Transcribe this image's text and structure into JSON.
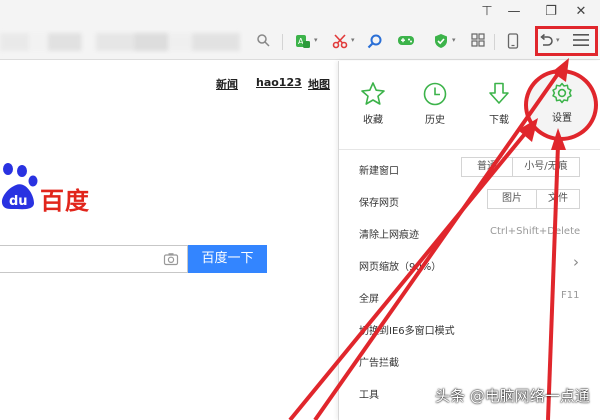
{
  "window_controls": {
    "skin": "⊤",
    "minimize": "—",
    "restore": "❐",
    "close": "✕"
  },
  "toolbar": {
    "search_icon": "search-icon",
    "caret": "▾"
  },
  "page": {
    "top_links": [
      "新闻",
      "hao123",
      "地图"
    ],
    "logo_text": "百度",
    "search_placeholder": "",
    "search_button": "百度一下"
  },
  "panel": {
    "quick": [
      {
        "icon": "star-icon",
        "label": "收藏"
      },
      {
        "icon": "clock-icon",
        "label": "历史"
      },
      {
        "icon": "download-icon",
        "label": "下载"
      },
      {
        "icon": "gear-icon",
        "label": "设置"
      }
    ],
    "new_window": {
      "label": "新建窗口",
      "btn1": "普通",
      "btn2": "小号/无痕"
    },
    "save_page": {
      "label": "保存网页",
      "btn1": "图片",
      "btn2": "文件"
    },
    "clear_traces": {
      "label": "清除上网痕迹",
      "shortcut": "Ctrl+Shift+Delete"
    },
    "zoom": {
      "label": "网页缩放（90%）",
      "arrow": "›"
    },
    "fullscreen": {
      "label": "全屏",
      "shortcut": "F11"
    },
    "ie6_mode": {
      "label": "切换到IE6多窗口模式"
    },
    "ad_block": {
      "label": "广告拦截"
    },
    "tools": {
      "label": "工具"
    }
  },
  "watermark": "头条 @电脑网络一点通",
  "colors": {
    "accent_green": "#3cb34a",
    "highlight_red": "#e0262c",
    "baidu_blue": "#3385ff",
    "baidu_red": "#e1251b"
  }
}
